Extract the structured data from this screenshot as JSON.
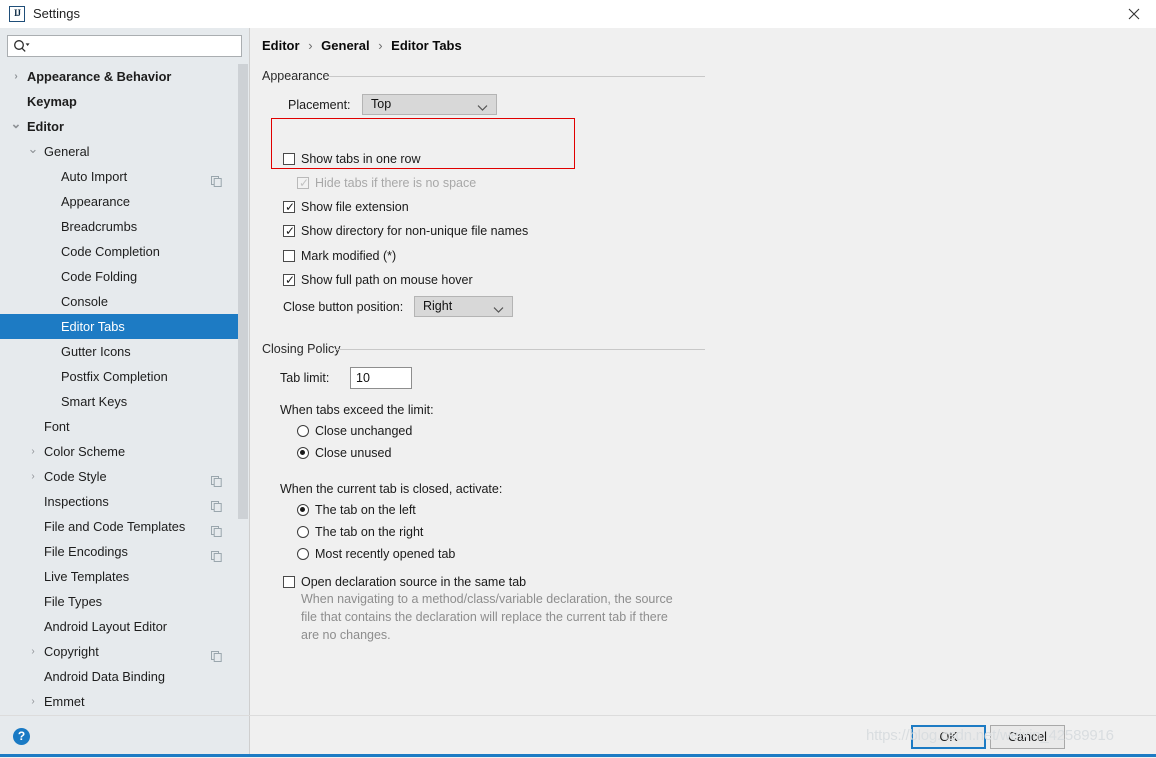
{
  "window": {
    "title": "Settings",
    "app_icon": "intellij-idea-icon",
    "close_label": "✕"
  },
  "search": {
    "value": "",
    "placeholder": "",
    "icon": "search-icon"
  },
  "sidebar": {
    "items": [
      {
        "label": "Appearance & Behavior",
        "level": 0,
        "arrow": "›",
        "bold": true,
        "selected": false,
        "copy": false
      },
      {
        "label": "Keymap",
        "level": 0,
        "arrow": "",
        "bold": true,
        "selected": false,
        "copy": false
      },
      {
        "label": "Editor",
        "level": 0,
        "arrow": "⌄",
        "bold": true,
        "selected": false,
        "copy": false
      },
      {
        "label": "General",
        "level": 1,
        "arrow": "⌄",
        "bold": false,
        "selected": false,
        "copy": false
      },
      {
        "label": "Auto Import",
        "level": 2,
        "arrow": "",
        "bold": false,
        "selected": false,
        "copy": true
      },
      {
        "label": "Appearance",
        "level": 2,
        "arrow": "",
        "bold": false,
        "selected": false,
        "copy": false
      },
      {
        "label": "Breadcrumbs",
        "level": 2,
        "arrow": "",
        "bold": false,
        "selected": false,
        "copy": false
      },
      {
        "label": "Code Completion",
        "level": 2,
        "arrow": "",
        "bold": false,
        "selected": false,
        "copy": false
      },
      {
        "label": "Code Folding",
        "level": 2,
        "arrow": "",
        "bold": false,
        "selected": false,
        "copy": false
      },
      {
        "label": "Console",
        "level": 2,
        "arrow": "",
        "bold": false,
        "selected": false,
        "copy": false
      },
      {
        "label": "Editor Tabs",
        "level": 2,
        "arrow": "",
        "bold": false,
        "selected": true,
        "copy": false
      },
      {
        "label": "Gutter Icons",
        "level": 2,
        "arrow": "",
        "bold": false,
        "selected": false,
        "copy": false
      },
      {
        "label": "Postfix Completion",
        "level": 2,
        "arrow": "",
        "bold": false,
        "selected": false,
        "copy": false
      },
      {
        "label": "Smart Keys",
        "level": 2,
        "arrow": "",
        "bold": false,
        "selected": false,
        "copy": false
      },
      {
        "label": "Font",
        "level": 1,
        "arrow": "",
        "bold": false,
        "selected": false,
        "copy": false
      },
      {
        "label": "Color Scheme",
        "level": 1,
        "arrow": "›",
        "bold": false,
        "selected": false,
        "copy": false
      },
      {
        "label": "Code Style",
        "level": 1,
        "arrow": "›",
        "bold": false,
        "selected": false,
        "copy": true
      },
      {
        "label": "Inspections",
        "level": 1,
        "arrow": "",
        "bold": false,
        "selected": false,
        "copy": true
      },
      {
        "label": "File and Code Templates",
        "level": 1,
        "arrow": "",
        "bold": false,
        "selected": false,
        "copy": true
      },
      {
        "label": "File Encodings",
        "level": 1,
        "arrow": "",
        "bold": false,
        "selected": false,
        "copy": true
      },
      {
        "label": "Live Templates",
        "level": 1,
        "arrow": "",
        "bold": false,
        "selected": false,
        "copy": false
      },
      {
        "label": "File Types",
        "level": 1,
        "arrow": "",
        "bold": false,
        "selected": false,
        "copy": false
      },
      {
        "label": "Android Layout Editor",
        "level": 1,
        "arrow": "",
        "bold": false,
        "selected": false,
        "copy": false
      },
      {
        "label": "Copyright",
        "level": 1,
        "arrow": "›",
        "bold": false,
        "selected": false,
        "copy": true
      },
      {
        "label": "Android Data Binding",
        "level": 1,
        "arrow": "",
        "bold": false,
        "selected": false,
        "copy": false
      },
      {
        "label": "Emmet",
        "level": 1,
        "arrow": "›",
        "bold": false,
        "selected": false,
        "copy": false
      }
    ]
  },
  "breadcrumb": {
    "part1": "Editor",
    "sep1": "›",
    "part2": "General",
    "sep2": "›",
    "part3": "Editor Tabs"
  },
  "appearance_section": {
    "title": "Appearance",
    "placement_label": "Placement:",
    "placement_value": "Top",
    "show_tabs_one_row": {
      "label": "Show tabs in one row",
      "checked": false,
      "disabled": false
    },
    "hide_tabs_no_space": {
      "label": "Hide tabs if there is no space",
      "checked": true,
      "disabled": true
    },
    "show_file_extension": {
      "label": "Show file extension",
      "checked": true,
      "disabled": false
    },
    "show_directory": {
      "label": "Show directory for non-unique file names",
      "checked": true,
      "disabled": false
    },
    "mark_modified": {
      "label": "Mark modified (*)",
      "checked": false,
      "disabled": false
    },
    "show_full_path": {
      "label": "Show full path on mouse hover",
      "checked": true,
      "disabled": false
    },
    "close_button_label": "Close button position:",
    "close_button_value": "Right"
  },
  "closing_policy_section": {
    "title": "Closing Policy",
    "tab_limit_label": "Tab limit:",
    "tab_limit_value": "10",
    "exceed_label": "When tabs exceed the limit:",
    "exceed_options": [
      {
        "label": "Close unchanged",
        "selected": false
      },
      {
        "label": "Close unused",
        "selected": true
      }
    ],
    "closed_label": "When the current tab is closed, activate:",
    "closed_options": [
      {
        "label": "The tab on the left",
        "selected": true
      },
      {
        "label": "The tab on the right",
        "selected": false
      },
      {
        "label": "Most recently opened tab",
        "selected": false
      }
    ],
    "open_declaration": {
      "label": "Open declaration source in the same tab",
      "checked": false
    },
    "hint_line1": "When navigating to a method/class/variable declaration, the source",
    "hint_line2": "file that contains the declaration will replace the current tab if there",
    "hint_line3": "are no changes."
  },
  "footer": {
    "help_label": "?",
    "ok_label": "OK",
    "cancel_label": "Cancel"
  },
  "watermark": {
    "text": "https://blog.csdn.net/weixin_42589916"
  },
  "colors": {
    "accent": "#1d7bc4",
    "sidebar_bg": "#e6eaed",
    "panel_bg": "#f0f0f0",
    "highlight_red": "#e00000",
    "disabled_text": "#a8a8a8"
  }
}
